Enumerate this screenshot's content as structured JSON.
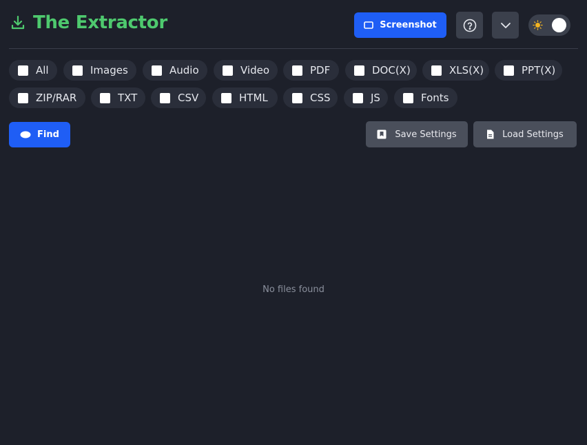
{
  "header": {
    "title": "The Extractor",
    "title_icon": "download-icon",
    "screenshot_label": "Screenshot",
    "help_icon": "help-circle-icon",
    "menu_icon": "chevron-down-icon",
    "theme_icon": "sun-icon"
  },
  "filters": {
    "row1": [
      {
        "label": "All",
        "checked": false
      },
      {
        "label": "Images",
        "checked": false
      },
      {
        "label": "Audio",
        "checked": false
      },
      {
        "label": "Video",
        "checked": false
      },
      {
        "label": "PDF",
        "checked": false
      },
      {
        "label": "DOC(X)",
        "checked": false
      },
      {
        "label": "XLS(X)",
        "checked": false
      },
      {
        "label": "PPT(X)",
        "checked": false
      }
    ],
    "row2": [
      {
        "label": "ZIP/RAR",
        "checked": false
      },
      {
        "label": "TXT",
        "checked": false
      },
      {
        "label": "CSV",
        "checked": false
      },
      {
        "label": "HTML",
        "checked": false
      },
      {
        "label": "CSS",
        "checked": false
      },
      {
        "label": "JS",
        "checked": false
      },
      {
        "label": "Fonts",
        "checked": false
      }
    ]
  },
  "actions": {
    "find_label": "Find",
    "save_label": "Save Settings",
    "load_label": "Load Settings"
  },
  "results": {
    "empty_message": "No files found"
  },
  "colors": {
    "background": "#1d202a",
    "accent_green": "#4ec96e",
    "primary_blue": "#1f5ef5",
    "chip_bg": "#2a2e3a",
    "button_gray": "#4a4f5b"
  }
}
